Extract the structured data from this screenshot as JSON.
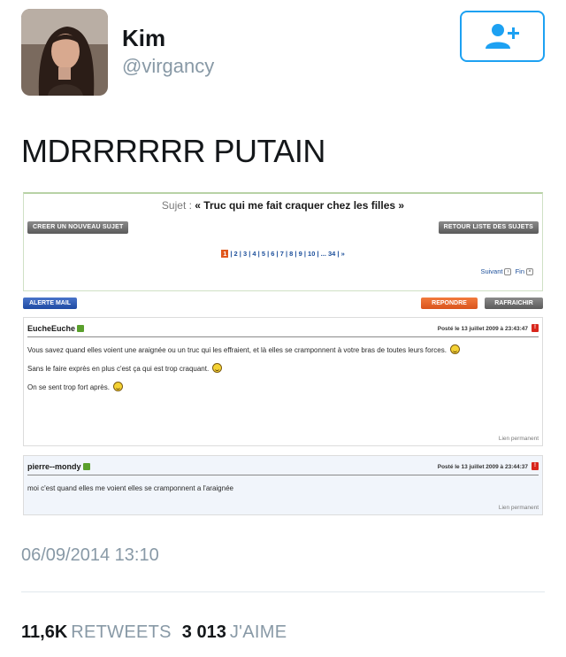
{
  "user": {
    "name": "Kim",
    "handle": "@virgancy"
  },
  "follow_icon": "add-user-icon",
  "tweet": {
    "text": "MDRRRRRR PUTAIN",
    "timestamp": "06/09/2014 13:10"
  },
  "stats": {
    "retweets_count": "11,6K",
    "retweets_label": "RETWEETS",
    "likes_count": "3 013",
    "likes_label": "J'AIME"
  },
  "colors": {
    "accent": "#1da1f2",
    "muted": "#8899a6",
    "forum_orange": "#e0571c",
    "forum_blue": "#1e4aa3"
  },
  "forum": {
    "subject_label": "Sujet :",
    "subject_title": "« Truc qui me fait craquer chez les filles »",
    "create_btn": "CREER UN NOUVEAU SUJET",
    "back_btn": "RETOUR LISTE DES SUJETS",
    "current_page": "1",
    "pages": "| 2 | 3 | 4 | 5 | 6 | 7 | 8 | 9 | 10 | ... 34 | »",
    "next_label": "Suivant",
    "end_label": "Fin",
    "alert_btn": "ALERTE MAIL",
    "reply_btn": "REPONDRE",
    "refresh_btn": "RAFRAICHIR",
    "permalink": "Lien permanent",
    "posts": [
      {
        "author": "EucheEuche",
        "date": "Posté le 13 juillet 2009 à 23:43:47",
        "lines": [
          "Vous savez quand elles voient une araignée ou un truc qui les effraient, et là elles se cramponnent à votre bras de toutes leurs forces.",
          "Sans le faire exprès en plus c'est ça qui est trop craquant.",
          "On se sent trop fort après."
        ]
      },
      {
        "author": "pierre--mondy",
        "date": "Posté le 13 juillet 2009 à 23:44:37",
        "lines": [
          "moi c'est quand elles me voient elles se cramponnent a l'araignée"
        ]
      }
    ]
  }
}
